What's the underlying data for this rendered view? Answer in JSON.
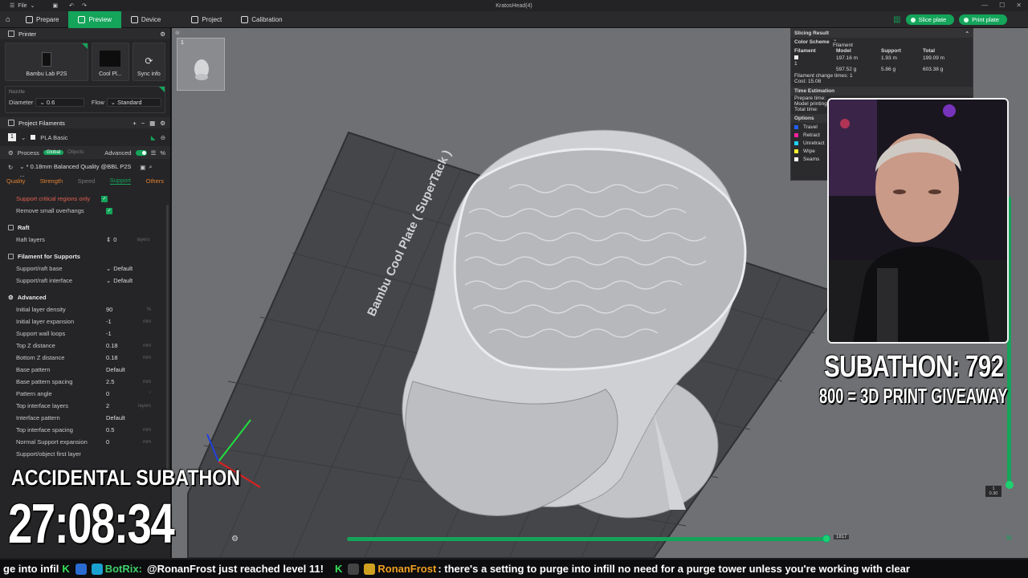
{
  "window": {
    "title": "KratosHead(4)",
    "menu_file": "File"
  },
  "toolbar": {
    "tabs": [
      {
        "label": "Prepare"
      },
      {
        "label": "Preview"
      },
      {
        "label": "Device"
      },
      {
        "label": "Project"
      },
      {
        "label": "Calibration"
      }
    ],
    "slice_label": "Slice plate",
    "print_label": "Print plate"
  },
  "printer": {
    "section_title": "Printer",
    "printer_name": "Bambu Lab P2S",
    "plate_name": "Cool Pl...",
    "sync_label": "Sync info",
    "nozzle_title": "Nozzle",
    "diameter_label": "Diameter",
    "diameter_value": "0.6",
    "flow_label": "Flow",
    "flow_value": "Standard"
  },
  "filaments": {
    "section_title": "Project Filaments",
    "items": [
      {
        "index": "1",
        "name": "PLA Basic"
      }
    ]
  },
  "process": {
    "title": "Process",
    "global_label": "Global",
    "objects_label": "Objects",
    "advanced_label": "Advanced",
    "preset": "* 0.18mm Balanced Quality @BBL P2S ...",
    "tabs": [
      "Quality",
      "Strength",
      "Speed",
      "Support",
      "Others"
    ]
  },
  "support": {
    "critical_label": "Support critical regions only",
    "small_overhangs_label": "Remove small overhangs",
    "raft_group": "Raft",
    "raft_layers_label": "Raft layers",
    "raft_layers_value": "0",
    "raft_layers_unit": "layers",
    "filament_group": "Filament for Supports",
    "raft_base_label": "Support/raft base",
    "raft_base_value": "Default",
    "raft_interface_label": "Support/raft interface",
    "raft_interface_value": "Default",
    "advanced_group": "Advanced",
    "rows": [
      {
        "label": "Initial layer density",
        "value": "90",
        "unit": "%"
      },
      {
        "label": "Initial layer expansion",
        "value": "-1",
        "unit": "mm"
      },
      {
        "label": "Support wall loops",
        "value": "-1",
        "unit": ""
      },
      {
        "label": "Top Z distance",
        "value": "0.18",
        "unit": "mm"
      },
      {
        "label": "Bottom Z distance",
        "value": "0.18",
        "unit": "mm"
      },
      {
        "label": "Base pattern",
        "value": "Default",
        "unit": ""
      },
      {
        "label": "Base pattern spacing",
        "value": "2.5",
        "unit": "mm"
      },
      {
        "label": "Pattern angle",
        "value": "0",
        "unit": "°"
      },
      {
        "label": "Top interface layers",
        "value": "2",
        "unit": "layers"
      },
      {
        "label": "Interface pattern",
        "value": "Default",
        "unit": ""
      },
      {
        "label": "Top interface spacing",
        "value": "0.5",
        "unit": "mm"
      },
      {
        "label": "Normal Support expansion",
        "value": "0",
        "unit": "mm"
      },
      {
        "label": "Support/object first layer",
        "value": "",
        "unit": ""
      }
    ]
  },
  "viewport": {
    "plate_number": "1",
    "plate_text": "Bambu Cool Plate ( SuperTack )",
    "slider_top_value": "1817",
    "layer_top": "1",
    "layer_top_z": "0.30"
  },
  "slicing_result": {
    "title": "Slicing Result",
    "color_scheme_label": "Color Scheme",
    "color_scheme_value": "Filament",
    "headers": [
      "Filament",
      "Model",
      "Support",
      "Total"
    ],
    "row": {
      "filament": "1",
      "model_m": "197.16 m",
      "model_g": "597.52 g",
      "support_m": "1.93 m",
      "support_g": "5.86 g",
      "total_m": "199.09 m",
      "total_g": "603.38 g"
    },
    "change_times": "Filament change times: 1",
    "cost": "Cost: 15.08",
    "time_title": "Time Estimation",
    "prepare_time": "Prepare time:",
    "model_printing": "Model printing",
    "total_time": "Total time:",
    "options_title": "Options",
    "options": [
      {
        "label": "Travel",
        "color": "#2060ff"
      },
      {
        "label": "Retract",
        "color": "#ff20a0"
      },
      {
        "label": "Unretract",
        "color": "#20d0ff"
      },
      {
        "label": "Wipe",
        "color": "#ffee30"
      },
      {
        "label": "Seams",
        "color": "#ffffff"
      }
    ]
  },
  "overlay": {
    "subathon_count": "SUBATHON: 792",
    "giveaway": "800 = 3D PRINT GIVEAWAY",
    "accidental": "ACCIDENTAL SUBATHON",
    "timer": "27:08:34"
  },
  "ticker": {
    "lead": "ge into infil",
    "user1": "BotRix:",
    "msg1": "@RonanFrost just reached level 11!",
    "user2": "RonanFrost",
    "msg2": ": there's a setting to purge into infill no need for a purge tower unless you're working with clear"
  },
  "colors": {
    "accent": "#14a45a",
    "orange": "#e08030"
  }
}
